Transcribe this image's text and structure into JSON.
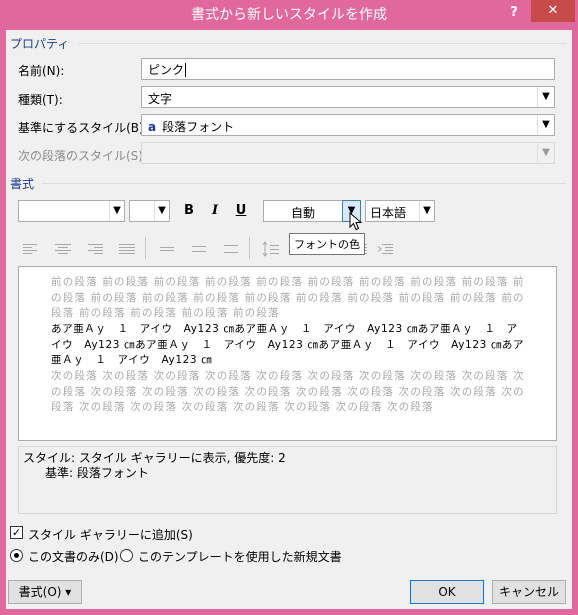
{
  "window": {
    "title": "書式から新しいスタイルを作成",
    "help": "?",
    "close": "✕"
  },
  "properties": {
    "heading": "プロパティ",
    "name_label": "名前(N):",
    "name_value": "ピンク",
    "type_label": "種類(T):",
    "type_value": "文字",
    "base_label": "基準にするスタイル(B):",
    "base_icon": "a",
    "base_value": "段落フォント",
    "next_label": "次の段落のスタイル(S):"
  },
  "formatting": {
    "heading": "書式",
    "font_name": "",
    "font_size": "",
    "bold": "B",
    "italic": "I",
    "underline": "U",
    "color_value": "自動",
    "language_value": "日本語",
    "tooltip": "フォントの色"
  },
  "preview": {
    "prev_text": "前の段落 前の段落 前の段落 前の段落 前の段落 前の段落 前の段落 前の段落 前の段落 前の段落 前の段落 前の段落 前の段落 前の段落 前の段落 前の段落 前の段落 前の段落 前の段落 前の段落 前の段落 前の段落 前の段落",
    "sample_text": "あア亜Ａｙ　１　アイウ　Ay123 ㎝あア亜Ａｙ　１　アイウ　Ay123 ㎝あア亜Ａｙ　１　アイウ　Ay123 ㎝あア亜Ａｙ　１　アイウ　Ay123 ㎝あア亜Ａｙ　１　アイウ　Ay123 ㎝あア亜Ａｙ　１　アイウ　Ay123 ㎝",
    "next_text": "次の段落 次の段落 次の段落 次の段落 次の段落 次の段落 次の段落 次の段落 次の段落 次の段落 次の段落 次の段落 次の段落 次の段落 次の段落 次の段落 次の段落 次の段落 次の段落 次の段落 次の段落 次の段落 次の段落 次の段落 次の段落 次の段落"
  },
  "description": {
    "line1": "スタイル: スタイル ギャラリーに表示, 優先度: 2",
    "line2": "基準: 段落フォント"
  },
  "options": {
    "add_gallery": "スタイル ギャラリーに追加(S)",
    "add_gallery_check": "✓",
    "this_doc": "この文書のみ(D)",
    "new_docs": "このテンプレートを使用した新規文書"
  },
  "buttons": {
    "format": "書式(O) ▾",
    "ok": "OK",
    "cancel": "キャンセル"
  },
  "colors": {
    "titlebar": "#e0689c",
    "close": "#c74b4b",
    "group_heading": "#1c3c8c"
  }
}
